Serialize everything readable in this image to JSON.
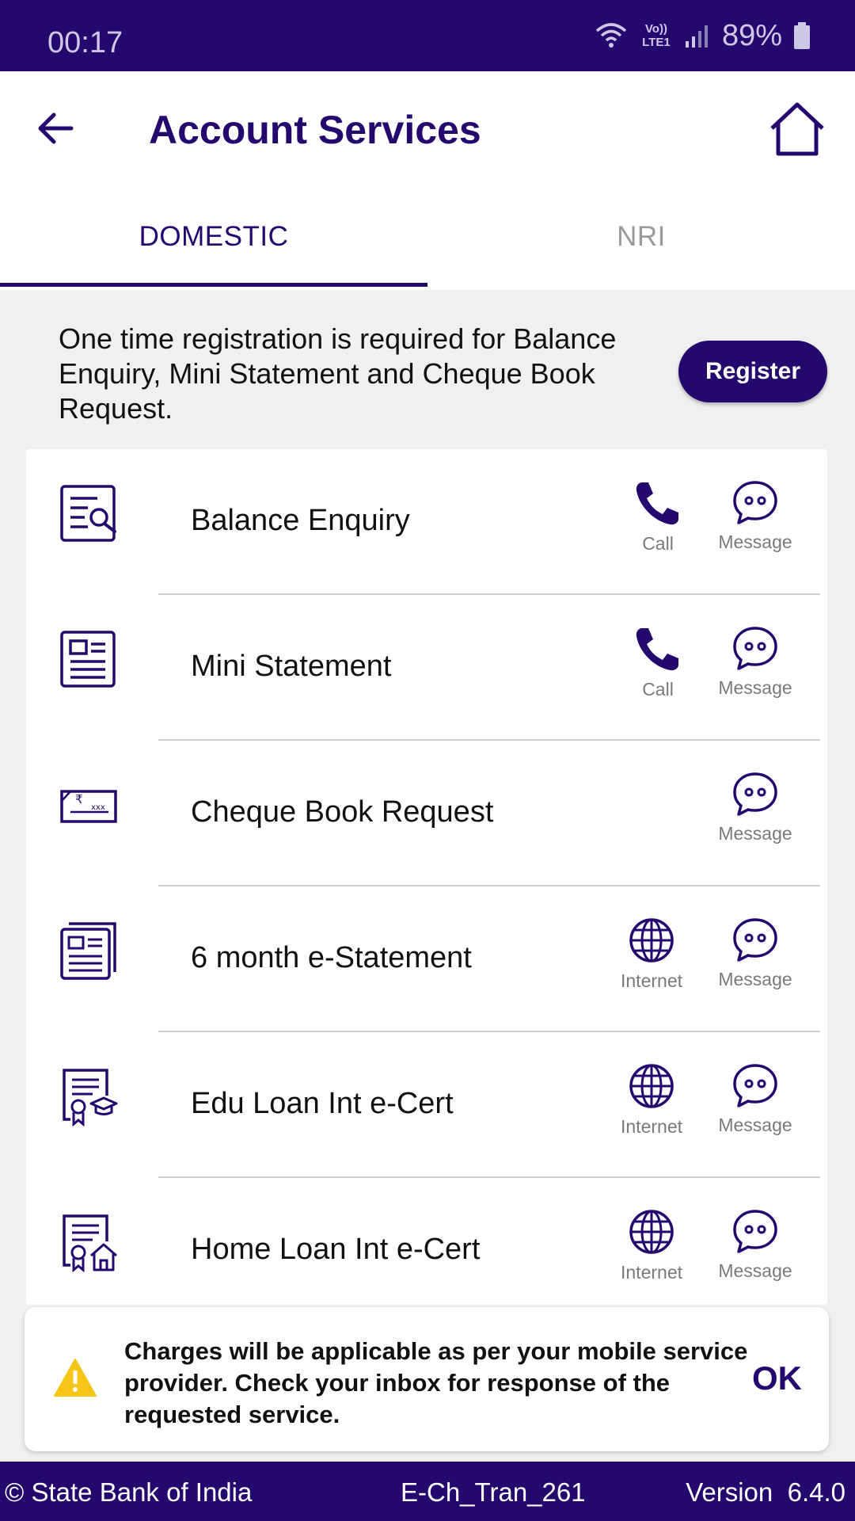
{
  "status_bar": {
    "time": "00:17",
    "network": "Vo)) LTE1",
    "battery": "89%"
  },
  "header": {
    "title": "Account Services"
  },
  "tabs": [
    {
      "label": "DOMESTIC",
      "active": true
    },
    {
      "label": "NRI",
      "active": false
    }
  ],
  "notice": {
    "text": "One time registration is required for Balance Enquiry, Mini Statement and Cheque Book Request.",
    "register_label": "Register"
  },
  "services": [
    {
      "label": "Balance Enquiry",
      "icon": "balance-enquiry-icon",
      "actions": [
        "Call",
        "Message"
      ]
    },
    {
      "label": "Mini Statement",
      "icon": "mini-statement-icon",
      "actions": [
        "Call",
        "Message"
      ]
    },
    {
      "label": "Cheque Book Request",
      "icon": "cheque-book-icon",
      "actions": [
        "Message"
      ]
    },
    {
      "label": "6 month e-Statement",
      "icon": "e-statement-icon",
      "actions": [
        "Internet",
        "Message"
      ]
    },
    {
      "label": "Edu Loan Int e-Cert",
      "icon": "edu-loan-cert-icon",
      "actions": [
        "Internet",
        "Message"
      ]
    },
    {
      "label": "Home Loan Int e-Cert",
      "icon": "home-loan-cert-icon",
      "actions": [
        "Internet",
        "Message"
      ]
    }
  ],
  "snackbar": {
    "text": "Charges will be applicable as per your mobile service provider. Check your inbox for response of the requested service.",
    "ok_label": "OK"
  },
  "footer": {
    "copyright": "© State Bank of India",
    "code": "E-Ch_Tran_261",
    "version": "Version  6.4.0"
  },
  "colors": {
    "primary": "#24086d",
    "warning": "#f5c518",
    "background": "#f0f0f0"
  }
}
